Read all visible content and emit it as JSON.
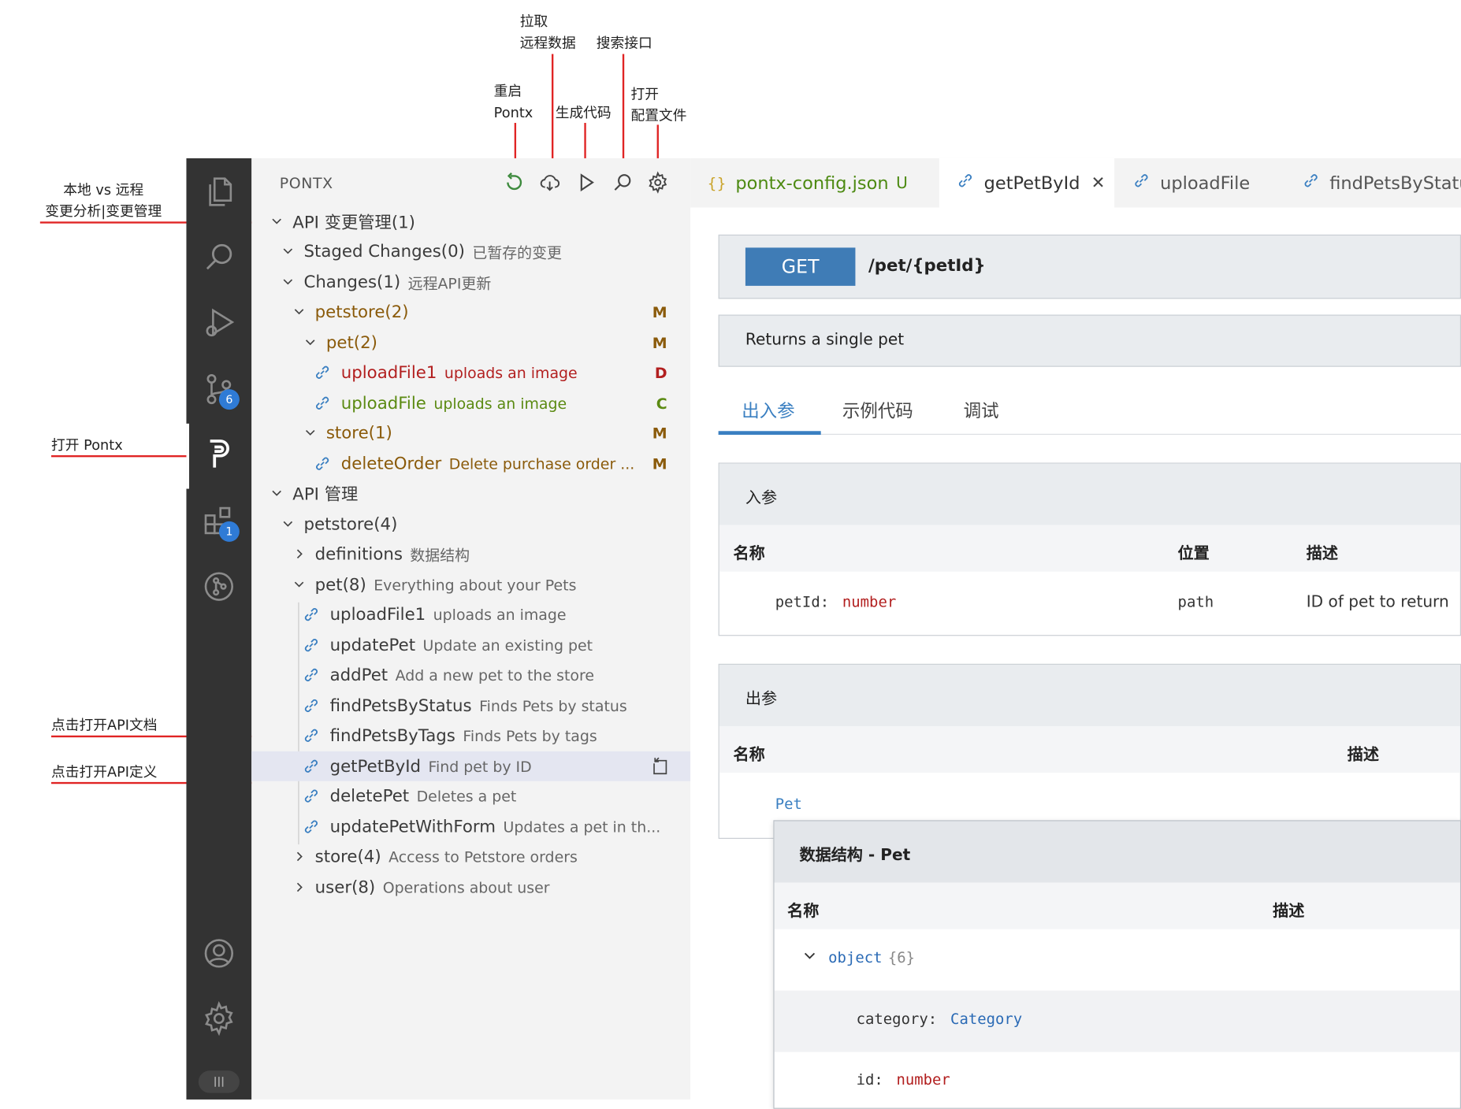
{
  "annotations": {
    "pull_remote": [
      "拉取",
      "远程数据"
    ],
    "search_api": "搜索接口",
    "restart": [
      "重启",
      "Pontx"
    ],
    "generate_code": "生成代码",
    "open_config": [
      "打开",
      "配置文件"
    ],
    "local_vs_remote": [
      "本地 vs 远程",
      "变更分析|变更管理"
    ],
    "open_pontx": "打开 Pontx",
    "open_api_doc": "点击打开API文档",
    "open_api_def": "点击打开API定义"
  },
  "activity_bar": {
    "scm_badge": "6",
    "ext_badge": "1"
  },
  "sidebar": {
    "title": "PONTX",
    "tree": [
      {
        "label": "API 变更管理(1)",
        "desc": "",
        "status": ""
      },
      {
        "label": "Staged Changes(0)",
        "desc": "已暂存的变更",
        "status": ""
      },
      {
        "label": "Changes(1)",
        "desc": "远程API更新",
        "status": ""
      },
      {
        "label": "petstore(2)",
        "desc": "",
        "status": "M"
      },
      {
        "label": "pet(2)",
        "desc": "",
        "status": "M"
      },
      {
        "label": "uploadFile1",
        "desc": "uploads an image",
        "status": "D"
      },
      {
        "label": "uploadFile",
        "desc": "uploads an image",
        "status": "C"
      },
      {
        "label": "store(1)",
        "desc": "",
        "status": "M"
      },
      {
        "label": "deleteOrder",
        "desc": "Delete purchase order ...",
        "status": "M"
      },
      {
        "label": "API 管理",
        "desc": "",
        "status": ""
      },
      {
        "label": "petstore(4)",
        "desc": "",
        "status": ""
      },
      {
        "label": "definitions",
        "desc": "数据结构",
        "status": ""
      },
      {
        "label": "pet(8)",
        "desc": "Everything about your Pets",
        "status": ""
      },
      {
        "label": "uploadFile1",
        "desc": "uploads an image",
        "status": ""
      },
      {
        "label": "updatePet",
        "desc": "Update an existing pet",
        "status": ""
      },
      {
        "label": "addPet",
        "desc": "Add a new pet to the store",
        "status": ""
      },
      {
        "label": "findPetsByStatus",
        "desc": "Finds Pets by status",
        "status": ""
      },
      {
        "label": "findPetsByTags",
        "desc": "Finds Pets by tags",
        "status": ""
      },
      {
        "label": "getPetById",
        "desc": "Find pet by ID",
        "status": ""
      },
      {
        "label": "deletePet",
        "desc": "Deletes a pet",
        "status": ""
      },
      {
        "label": "updatePetWithForm",
        "desc": "Updates a pet in th...",
        "status": ""
      },
      {
        "label": "store(4)",
        "desc": "Access to Petstore orders",
        "status": ""
      },
      {
        "label": "user(8)",
        "desc": "Operations about user",
        "status": ""
      }
    ]
  },
  "tabs": [
    {
      "label": "pontx-config.json",
      "suffix": "U"
    },
    {
      "label": "getPetById",
      "suffix": ""
    },
    {
      "label": "uploadFile",
      "suffix": ""
    },
    {
      "label": "findPetsByStatu",
      "suffix": ""
    }
  ],
  "doc": {
    "method": "GET",
    "path": "/pet/{petId}",
    "summary": "Returns a single pet",
    "subtabs": [
      "出入参",
      "示例代码",
      "调试"
    ],
    "params": {
      "title": "入参",
      "headers": [
        "名称",
        "位置",
        "描述"
      ],
      "row": {
        "name": "petId:",
        "type": "number",
        "in": "path",
        "desc": "ID of pet to return"
      }
    },
    "response": {
      "title": "出参",
      "headers": [
        "名称",
        "描述"
      ],
      "type": "Pet"
    },
    "schema": {
      "title": "数据结构 - Pet",
      "headers": [
        "名称",
        "描述"
      ],
      "object": "object",
      "count": "{6}",
      "fields": [
        {
          "name": "category:",
          "type": "Category"
        },
        {
          "name": "id:",
          "type": "number"
        }
      ]
    }
  },
  "colors": {
    "accent": "#3a7fc1",
    "method_bg": "#3f7cb6",
    "red": "#e02424"
  }
}
